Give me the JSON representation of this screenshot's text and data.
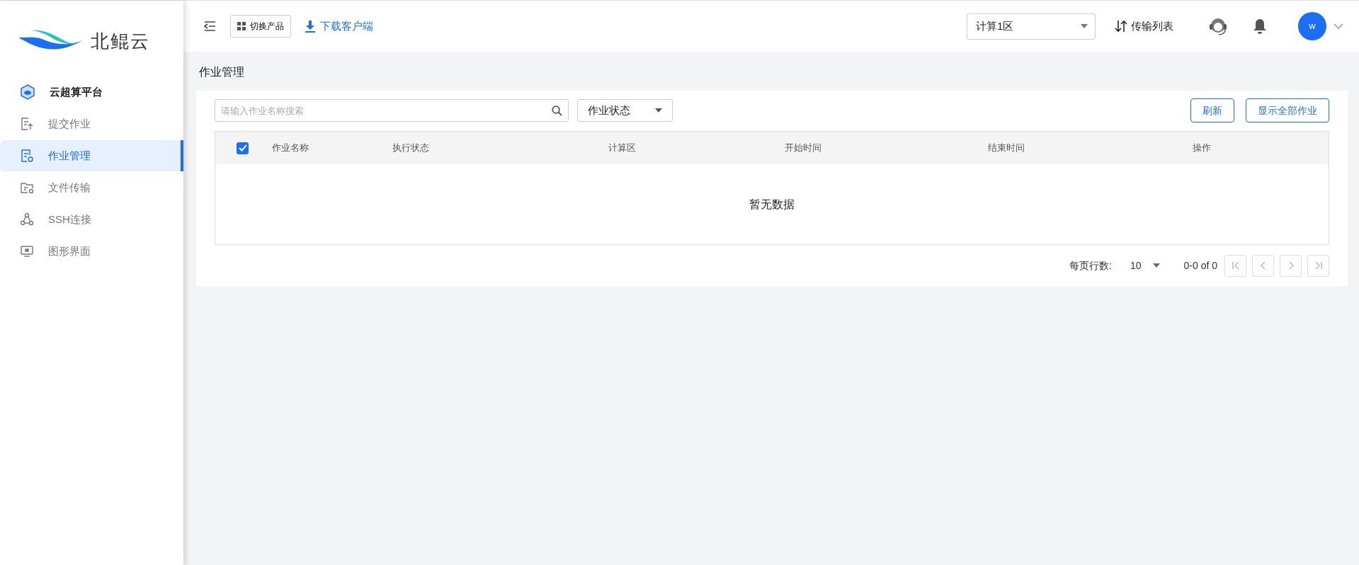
{
  "brand": {
    "name": "北鲲云"
  },
  "sidebar": {
    "items": [
      {
        "label": "云超算平台",
        "kind": "heading",
        "selected": false
      },
      {
        "label": "提交作业",
        "kind": "link",
        "selected": false
      },
      {
        "label": "作业管理",
        "kind": "link",
        "selected": true
      },
      {
        "label": "文件传输",
        "kind": "link",
        "selected": false
      },
      {
        "label": "SSH连接",
        "kind": "link",
        "selected": false
      },
      {
        "label": "图形界面",
        "kind": "link",
        "selected": false
      }
    ]
  },
  "topbar": {
    "switch_product": "切换产品",
    "download": "下载客户端",
    "region": "计算1区",
    "transfer_list": "传输列表",
    "avatar": "w"
  },
  "page_title": "作业管理",
  "toolbar": {
    "search": {
      "placeholder": "请输入作业名称搜索"
    },
    "status_filter": "作业状态",
    "buttons": [
      "刷新",
      "显示全部作业"
    ]
  },
  "table": {
    "select_all_checked": true,
    "columns": [
      "作业名称",
      "执行状态",
      "计算区",
      "开始时间",
      "结束时间",
      "操作"
    ],
    "empty_text": "暂无数据"
  },
  "pagination": {
    "rows_per_page_label": "每页行数:",
    "rows_per_page": "10",
    "range": "0-0 of 0"
  }
}
